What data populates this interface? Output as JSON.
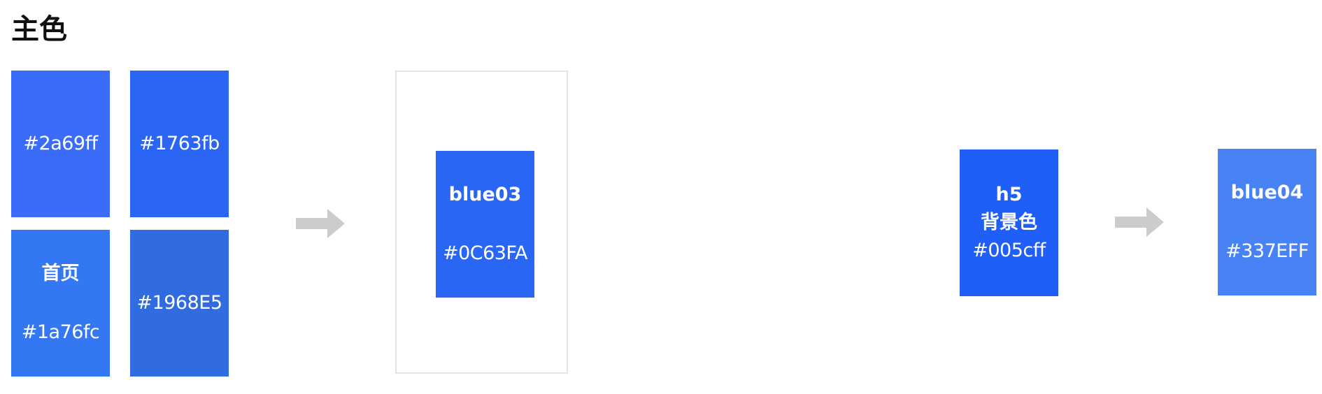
{
  "page": {
    "title": "主色"
  },
  "colors": {
    "arrow": "#cccccc",
    "frame_border": "#e5e5e5"
  },
  "swatches": {
    "s1": {
      "hex": "#2a69ff",
      "color": "#3a6cf8"
    },
    "s2": {
      "hex": "#1763fb",
      "color": "#2b65f4"
    },
    "s3": {
      "name": "首页",
      "hex": "#1a76fc",
      "color": "#3477f3"
    },
    "s4": {
      "hex": "#1968E5",
      "color": "#306be0"
    },
    "blue03": {
      "name": "blue03",
      "hex": "#0C63FA",
      "color": "#2a66f4"
    },
    "h5": {
      "name_line1": "h5",
      "name_line2": "背景色",
      "hex": "#005cff",
      "color": "#1f5ef7"
    },
    "blue04": {
      "name": "blue04",
      "hex": "#337EFF",
      "color": "#4883f5"
    }
  }
}
